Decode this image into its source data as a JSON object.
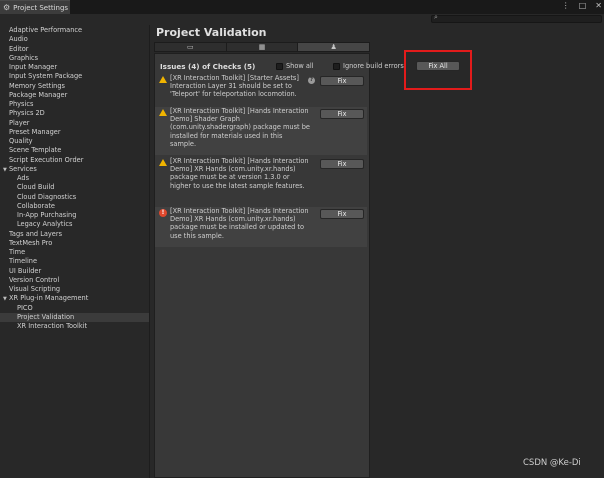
{
  "window": {
    "tab_title": "Project Settings",
    "controls": [
      "⋮",
      "□",
      "✕"
    ]
  },
  "search": {
    "placeholder": ""
  },
  "sidebar": {
    "items": [
      {
        "label": "Adaptive Performance",
        "indent": 0
      },
      {
        "label": "Audio",
        "indent": 0
      },
      {
        "label": "Editor",
        "indent": 0
      },
      {
        "label": "Graphics",
        "indent": 0
      },
      {
        "label": "Input Manager",
        "indent": 0
      },
      {
        "label": "Input System Package",
        "indent": 0
      },
      {
        "label": "Memory Settings",
        "indent": 0
      },
      {
        "label": "Package Manager",
        "indent": 0
      },
      {
        "label": "Physics",
        "indent": 0
      },
      {
        "label": "Physics 2D",
        "indent": 0
      },
      {
        "label": "Player",
        "indent": 0
      },
      {
        "label": "Preset Manager",
        "indent": 0
      },
      {
        "label": "Quality",
        "indent": 0
      },
      {
        "label": "Scene Template",
        "indent": 0
      },
      {
        "label": "Script Execution Order",
        "indent": 0
      },
      {
        "label": "Services",
        "indent": 0,
        "expanded": true
      },
      {
        "label": "Ads",
        "indent": 1
      },
      {
        "label": "Cloud Build",
        "indent": 1
      },
      {
        "label": "Cloud Diagnostics",
        "indent": 1
      },
      {
        "label": "Collaborate",
        "indent": 1
      },
      {
        "label": "In-App Purchasing",
        "indent": 1
      },
      {
        "label": "Legacy Analytics",
        "indent": 1
      },
      {
        "label": "Tags and Layers",
        "indent": 0
      },
      {
        "label": "TextMesh Pro",
        "indent": 0
      },
      {
        "label": "Time",
        "indent": 0
      },
      {
        "label": "Timeline",
        "indent": 0
      },
      {
        "label": "UI Builder",
        "indent": 0
      },
      {
        "label": "Version Control",
        "indent": 0
      },
      {
        "label": "Visual Scripting",
        "indent": 0
      },
      {
        "label": "XR Plug-in Management",
        "indent": 0,
        "expanded": true
      },
      {
        "label": "PICO",
        "indent": 1
      },
      {
        "label": "Project Validation",
        "indent": 1,
        "selected": true
      },
      {
        "label": "XR Interaction Toolkit",
        "indent": 1
      }
    ]
  },
  "main": {
    "title": "Project Validation",
    "platform_tabs": [
      {
        "icon": "monitor-icon",
        "glyph": "▭"
      },
      {
        "icon": "server-icon",
        "glyph": "▦"
      },
      {
        "icon": "android-icon",
        "glyph": "♟",
        "active": true
      }
    ],
    "issues_header": "Issues (4) of Checks (5)",
    "show_all_label": "Show all",
    "ignore_build_errors_label": "Ignore build errors",
    "fix_all_label": "Fix All",
    "fix_label": "Fix",
    "issues": [
      {
        "severity": "warning",
        "text": "[XR Interaction Toolkit] [Starter Assets] Interaction Layer 31 should be set to 'Teleport' for teleportation locomotion.",
        "help": "?"
      },
      {
        "severity": "warning",
        "text": "[XR Interaction Toolkit] [Hands Interaction Demo] Shader Graph (com.unity.shadergraph) package must be installed for materials used in this sample."
      },
      {
        "severity": "warning",
        "text": "[XR Interaction Toolkit] [Hands Interaction Demo] XR Hands (com.unity.xr.hands) package must be at version 1.3.0 or higher to use the latest sample features."
      },
      {
        "severity": "error",
        "text": "[XR Interaction Toolkit] [Hands Interaction Demo] XR Hands (com.unity.xr.hands) package must be installed or updated to use this sample."
      }
    ]
  },
  "watermark": "CSDN @Ke-Di",
  "colors": {
    "highlight": "#e21b1b",
    "warning": "#f0b400",
    "error": "#e1482d"
  }
}
